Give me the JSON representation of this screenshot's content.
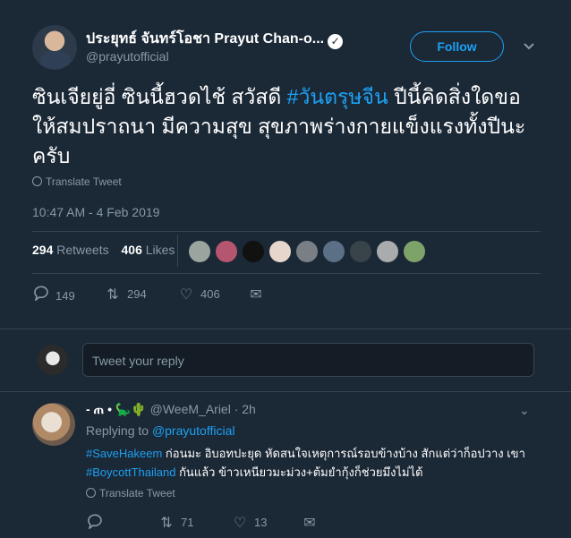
{
  "author": {
    "name": "ประยุทธ์ จันทร์โอชา Prayut Chan-o...",
    "handle": "@prayutofficial",
    "follow_label": "Follow"
  },
  "tweet": {
    "text_before": "ซินเจียยู่อี่ ซินนี้ฮวดไช้ สวัสดี ",
    "hashtag": "#วันตรุษจีน",
    "text_after": " ปีนี้คิดสิ่งใดขอให้สมปราถนา มีความสุข สุขภาพร่างกายแข็งแรงทั้งปีนะครับ",
    "translate_label": "Translate Tweet",
    "timestamp": "10:47 AM - 4 Feb 2019",
    "retweets_count": "294",
    "retweets_label": "Retweets",
    "likes_count": "406",
    "likes_label": "Likes",
    "reply_count": "149",
    "retweet_count": "294",
    "like_count": "406"
  },
  "reply_box": {
    "placeholder": "Tweet your reply"
  },
  "reply": {
    "name": "- ጠ • 🦕🌵",
    "handle": "@WeeM_Ariel",
    "time": "· 2h",
    "replying_prefix": "Replying to",
    "replying_handle": "@prayutofficial",
    "hashtag1": "#SaveHakeem",
    "text1": " ก่อนมะ อิบอทปะยุด หัดสนใจเหตุการณ์รอบข้างบ้าง สักแต่ว่าก็อปวาง เขา",
    "hashtag2": "#BoycottThailand",
    "text2": " กันแล้ว ข้าวเหนียวมะม่วง+ต้มยำกุ้งก็ช่วยมึงไม่ได้",
    "translate_label": "Translate Tweet",
    "retweet_count": "71",
    "like_count": "13"
  },
  "colors": {
    "accent": "#1da1f2",
    "background": "#1b2836",
    "muted": "#8899a6"
  }
}
